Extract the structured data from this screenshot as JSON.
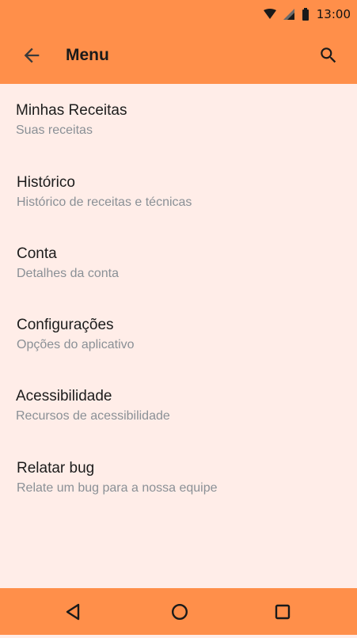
{
  "status_bar": {
    "time": "13:00",
    "icons": [
      "wifi-icon",
      "signal-icon",
      "battery-icon"
    ]
  },
  "app_bar": {
    "title": "Menu",
    "back_icon": "arrow-back-icon",
    "search_icon": "search-icon"
  },
  "menu": {
    "items": [
      {
        "title": "Minhas Receitas",
        "subtitle": "Suas receitas"
      },
      {
        "title": "Histórico",
        "subtitle": "Histórico de receitas e técnicas"
      },
      {
        "title": "Conta",
        "subtitle": "Detalhes da conta"
      },
      {
        "title": "Configurações",
        "subtitle": "Opções do aplicativo"
      },
      {
        "title": "Acessibilidade",
        "subtitle": "Recursos de acessibilidade"
      },
      {
        "title": "Relatar bug",
        "subtitle": "Relate um bug para a nossa equipe"
      }
    ]
  },
  "nav_bar": {
    "icons": [
      "back-triangle-icon",
      "home-circle-icon",
      "recents-square-icon"
    ]
  },
  "colors": {
    "accent": "#FF8F4A",
    "background": "#FFEDE8",
    "title_text": "#1C1C1C",
    "subtitle_text": "#8A9096"
  }
}
